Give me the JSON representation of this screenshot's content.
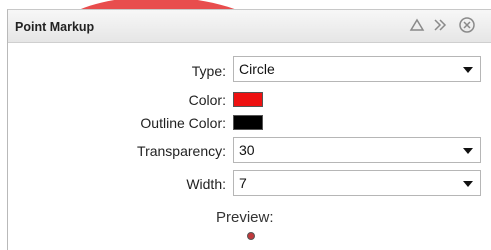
{
  "panel": {
    "title": "Point Markup"
  },
  "header_icons": [
    "up-triangle-icon",
    "double-chevron-right-icon",
    "close-circle-icon"
  ],
  "form": {
    "type": {
      "label": "Type:",
      "value": "Circle"
    },
    "color": {
      "label": "Color:",
      "value": "#ee1111"
    },
    "outline_color": {
      "label": "Outline Color:",
      "value": "#000000"
    },
    "transparency": {
      "label": "Transparency:",
      "value": "30"
    },
    "width": {
      "label": "Width:",
      "value": "7"
    }
  },
  "preview": {
    "label": "Preview:",
    "fill": "#c0393c",
    "outline": "#555555"
  },
  "colors": {
    "accent_red": "#e53a3a"
  }
}
